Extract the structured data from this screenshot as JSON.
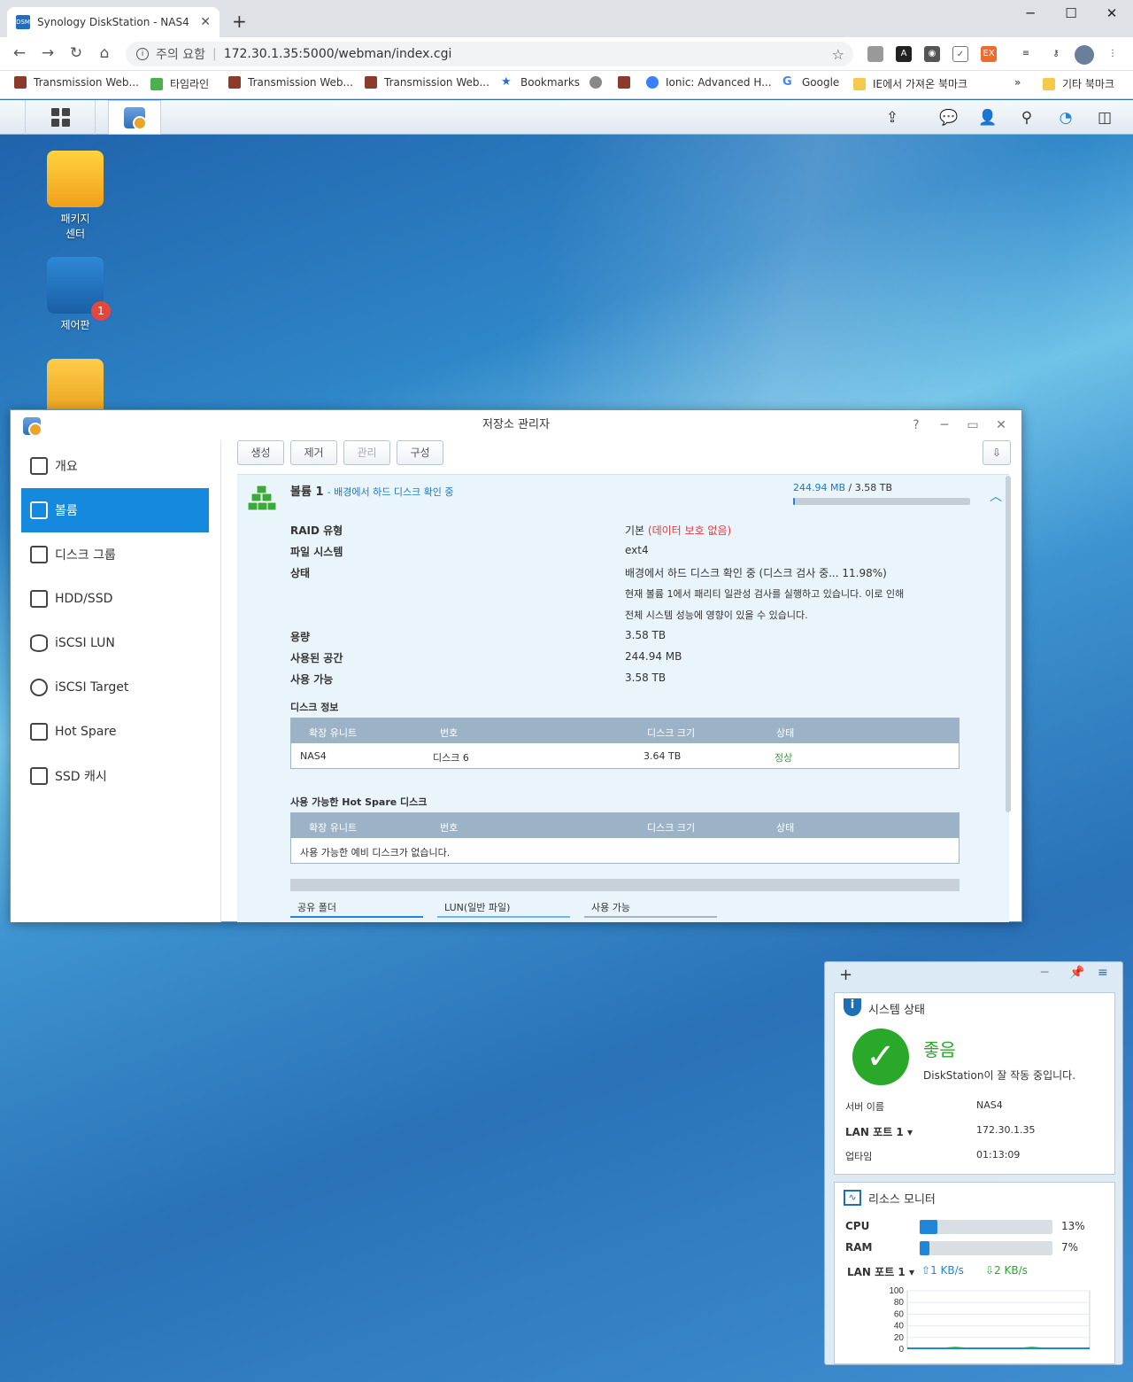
{
  "browser": {
    "tab_title": "Synology DiskStation - NAS4",
    "favicon_text": "DSM",
    "security_label": "주의 요함",
    "url": "172.30.1.35:5000/webman/index.cgi",
    "bookmarks": [
      {
        "label": "Transmission Web...",
        "icon": "transmission-icon"
      },
      {
        "label": "타임라인",
        "icon": "maps-icon"
      },
      {
        "label": "Transmission Web...",
        "icon": "transmission-icon"
      },
      {
        "label": "Transmission Web...",
        "icon": "transmission-icon"
      },
      {
        "label": "Bookmarks",
        "icon": "star-icon"
      },
      {
        "label": "Ionic: Advanced H...",
        "icon": "ionic-icon"
      },
      {
        "label": "Google",
        "icon": "google-icon"
      },
      {
        "label": "IE에서 가져온 북마크",
        "icon": "folder-icon"
      }
    ],
    "other_bookmarks": "기타 북마크",
    "more": "»",
    "ext_badge": "EX"
  },
  "desktop": {
    "icons": [
      {
        "label_line1": "패키지",
        "label_line2": "센터"
      },
      {
        "label_line1": "제어판",
        "label_line2": "",
        "badge": "1"
      },
      {
        "label_line1": "",
        "label_line2": ""
      }
    ]
  },
  "window": {
    "title": "저장소 관리자",
    "sidebar": [
      {
        "label": "개요",
        "active": false
      },
      {
        "label": "볼륨",
        "active": true
      },
      {
        "label": "디스크 그룹",
        "active": false
      },
      {
        "label": "HDD/SSD",
        "active": false
      },
      {
        "label": "iSCSI LUN",
        "active": false
      },
      {
        "label": "iSCSI Target",
        "active": false
      },
      {
        "label": "Hot Spare",
        "active": false
      },
      {
        "label": "SSD 캐시",
        "active": false
      }
    ],
    "toolbar": {
      "create": "생성",
      "remove": "제거",
      "manage": "관리",
      "configure": "구성"
    },
    "volume": {
      "name": "볼륨 1",
      "status_suffix": "- 배경에서 하드 디스크 확인 중",
      "usage_used": "244.94 MB",
      "usage_total": "/ 3.58 TB",
      "raid_label": "RAID 유형",
      "raid_value": "기본",
      "raid_note": "(데이터 보호 없음)",
      "fs_label": "파일 시스템",
      "fs_value": "ext4",
      "state_label": "상태",
      "state_value": "배경에서 하드 디스크 확인 중 (디스크 검사 중... 11.98%)",
      "state_warn1": "현재 볼륨 1에서 패리티 일관성 검사를 실행하고 있습니다. 이로 인해",
      "state_warn2": "전체 시스템 성능에 영향이 있을 수 있습니다.",
      "cap_label": "용량",
      "cap_value": "3.58 TB",
      "used_label": "사용된 공간",
      "used_value": "244.94 MB",
      "avail_label": "사용 가능",
      "avail_value": "3.58 TB"
    },
    "disk_info": {
      "title": "디스크 정보",
      "headers": [
        "확장 유니트",
        "번호",
        "디스크 크기",
        "상태"
      ],
      "row": [
        "NAS4",
        "디스크 6",
        "3.64 TB",
        "정상"
      ]
    },
    "hotspare": {
      "title": "사용 가능한 Hot Spare 디스크",
      "headers": [
        "확장 유니트",
        "번호",
        "디스크 크기",
        "상태"
      ],
      "empty": "사용 가능한 예비 디스크가 없습니다."
    },
    "legend": [
      "공유 폴더",
      "LUN(일반 파일)",
      "사용 가능"
    ]
  },
  "widget": {
    "sys_title": "시스템 상태",
    "sys_status": "좋음",
    "sys_message": "DiskStation이 잘 작동 중입니다.",
    "server_name_label": "서버 이름",
    "server_name": "NAS4",
    "lan_label": "LAN 포트 1",
    "lan_ip": "172.30.1.35",
    "uptime_label": "업타임",
    "uptime": "01:13:09",
    "res_title": "리소스 모니터",
    "cpu_label": "CPU",
    "cpu_text": "13%",
    "cpu": 0.13,
    "ram_label": "RAM",
    "ram_text": "7%",
    "ram": 0.07,
    "net_label": "LAN 포트 1",
    "upload": "1 KB/s",
    "download": "2 KB/s"
  },
  "chart_data": {
    "type": "line",
    "yticks": [
      "100",
      "80",
      "60",
      "40",
      "20",
      "0"
    ],
    "ylim": [
      0,
      100
    ],
    "series": [
      {
        "values": [
          2,
          2,
          2,
          2,
          2,
          3,
          2,
          2,
          2,
          2,
          2,
          2,
          2,
          3,
          2,
          2,
          2,
          2,
          2,
          2
        ]
      },
      {
        "values": [
          1,
          1,
          1,
          1,
          1,
          1,
          1,
          1,
          1,
          1,
          1,
          1,
          1,
          1,
          1,
          1,
          1,
          1,
          1,
          1
        ]
      }
    ]
  }
}
